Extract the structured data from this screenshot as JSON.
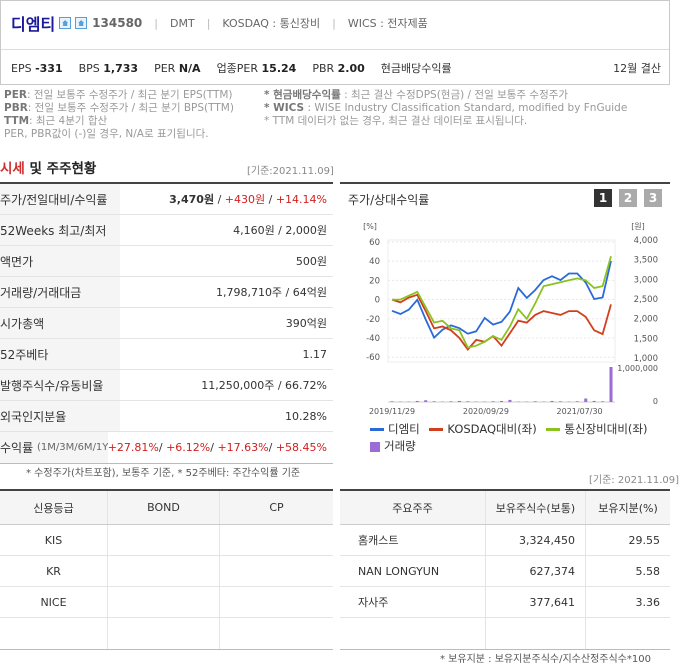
{
  "header": {
    "company": "디엠티",
    "code": "134580",
    "ticker": "DMT",
    "market": "KOSDAQ : 통신장비",
    "wics": "WICS : 전자제품",
    "metrics": [
      {
        "label": "EPS",
        "value": "-331"
      },
      {
        "label": "BPS",
        "value": "1,733"
      },
      {
        "label": "PER",
        "value": "N/A"
      },
      {
        "label": "업종PER",
        "value": "15.24"
      },
      {
        "label": "PBR",
        "value": "2.00"
      },
      {
        "label": "현금배당수익률",
        "value": ""
      }
    ],
    "fiscal": "12월 결산"
  },
  "notes_left": [
    {
      "key": "PER",
      "text": ": 전일 보통주 수정주가 / 최근 분기 EPS(TTM)"
    },
    {
      "key": "PBR",
      "text": ": 전일 보통주 수정주가 / 최근 분기 BPS(TTM)"
    },
    {
      "key": "TTM",
      "text": ": 최근 4분기 합산"
    },
    {
      "key": "",
      "text": "PER, PBR값이 (-)일 경우, N/A로 표기됩니다."
    }
  ],
  "notes_right": [
    {
      "key": "* 현금배당수익률",
      "text": " : 최근 결산 수정DPS(현금) / 전일 보통주 수정주가"
    },
    {
      "key": "* WICS",
      "text": " : WISE Industry Classification Standard, modified by FnGuide"
    },
    {
      "key": "",
      "text": "* TTM 데이터가 없는 경우, 최근 결산 데이터로 표시됩니다."
    }
  ],
  "section": {
    "title_hl": "시세",
    "title_rest": " 및 주주현황",
    "date": "[기준:2021.11.09]"
  },
  "market_table": [
    {
      "label": "주가/전일대비/수익률",
      "price": "3,470원",
      "change": "+430원",
      "rate": "+14.14%"
    },
    {
      "label": "52Weeks 최고/최저",
      "value": "4,160원 / 2,000원"
    },
    {
      "label": "액면가",
      "value": "500원"
    },
    {
      "label": "거래량/거래대금",
      "value": "1,798,710주 / 64억원"
    },
    {
      "label": "시가총액",
      "value": "390억원"
    },
    {
      "label": "52주베타",
      "value": "1.17"
    },
    {
      "label": "발행주식수/유동비율",
      "value": "11,250,000주 / 66.72%"
    },
    {
      "label": "외국인지분율",
      "value": "10.28%"
    },
    {
      "label": "수익률",
      "label_sub": "(1M/3M/6M/1Y)",
      "returns": [
        "+27.81%",
        "+6.12%",
        "+17.63%",
        "+58.45%"
      ]
    }
  ],
  "market_note": "* 수정주가(차트포함), 보통주 기준, * 52주베타: 주간수익률 기준",
  "chart": {
    "title": "주가/상대수익률",
    "pages": [
      "1",
      "2",
      "3"
    ],
    "active_page": "1",
    "left_unit": "[%]",
    "right_unit": "[원]",
    "legend": [
      "디엠티",
      "KOSDAQ대비(좌)",
      "통신장비대비(좌)",
      "거래량"
    ],
    "colors": {
      "stock": "#2a6ad8",
      "kosdaq": "#d0401e",
      "telecom": "#8bc220",
      "volume": "#9b6bd6"
    }
  },
  "chart_data": {
    "type": "line",
    "x": [
      "2019/11/29",
      "2019/12/27",
      "2020/01/24",
      "2020/02/21",
      "2020/03/20",
      "2020/04/17",
      "2020/05/15",
      "2020/06/12",
      "2020/07/10",
      "2020/08/07",
      "2020/09/04",
      "2020/10/02",
      "2020/10/30",
      "2020/11/27",
      "2020/12/25",
      "2021/01/22",
      "2021/02/19",
      "2021/03/19",
      "2021/04/16",
      "2021/05/14",
      "2021/06/11",
      "2021/07/09",
      "2021/08/06",
      "2021/09/03",
      "2021/10/01",
      "2021/10/29",
      "2021/11/09"
    ],
    "x_ticks": [
      "2019/11/29",
      "2020/09/29",
      "2021/07/30"
    ],
    "y_left_ticks": [
      "60",
      "40",
      "20",
      "0",
      "-20",
      "-40",
      "-60"
    ],
    "y_right_ticks": [
      "4,000",
      "3,500",
      "3,000",
      "2,500",
      "2,000",
      "1,500",
      "1,000"
    ],
    "vol_ticks": [
      "1,000,000",
      "0"
    ],
    "ylim_left": [
      -65,
      62
    ],
    "ylim_right": [
      900,
      4000
    ],
    "series": [
      {
        "name": "디엠티",
        "axis": "right",
        "values": [
          2200,
          2120,
          2230,
          2480,
          1980,
          1520,
          1720,
          1830,
          1760,
          1620,
          1680,
          2020,
          1850,
          1920,
          2180,
          2780,
          2530,
          2730,
          2980,
          3080,
          2980,
          3150,
          3150,
          2920,
          2500,
          2540,
          3470
        ]
      },
      {
        "name": "KOSDAQ대비(좌)",
        "axis": "left",
        "values": [
          0,
          -3,
          2,
          5,
          -12,
          -30,
          -28,
          -32,
          -40,
          -52,
          -42,
          -44,
          -38,
          -48,
          -35,
          -22,
          -24,
          -16,
          -12,
          -14,
          -16,
          -12,
          -12,
          -18,
          -32,
          -36,
          -5
        ]
      },
      {
        "name": "통신장비대비(좌)",
        "axis": "left",
        "values": [
          0,
          0,
          4,
          8,
          -8,
          -24,
          -22,
          -30,
          -32,
          -50,
          -48,
          -44,
          -38,
          -42,
          -28,
          -10,
          -20,
          -4,
          14,
          16,
          18,
          20,
          22,
          20,
          12,
          14,
          45
        ]
      }
    ],
    "volume": [
      2,
      1,
      1,
      3,
      5,
      2,
      1,
      2,
      3,
      2,
      1,
      1,
      2,
      3,
      6,
      1,
      1,
      2,
      1,
      3,
      2,
      1,
      2,
      10,
      3,
      2,
      100
    ]
  },
  "credit_table": {
    "headers": [
      "신용등급",
      "BOND",
      "CP"
    ],
    "rows": [
      [
        "KIS",
        "",
        ""
      ],
      [
        "KR",
        "",
        ""
      ],
      [
        "NICE",
        "",
        ""
      ]
    ]
  },
  "holders": {
    "date": "[기준: 2021.11.09]",
    "headers": [
      "주요주주",
      "보유주식수(보통)",
      "보유지분(%)"
    ],
    "rows": [
      [
        "홈캐스트",
        "3,324,450",
        "29.55"
      ],
      [
        "NAN LONGYUN",
        "627,374",
        "5.58"
      ],
      [
        "자사주",
        "377,641",
        "3.36"
      ]
    ],
    "note": "* 보유지분 : 보유지분주식수/지수산정주식수*100"
  }
}
